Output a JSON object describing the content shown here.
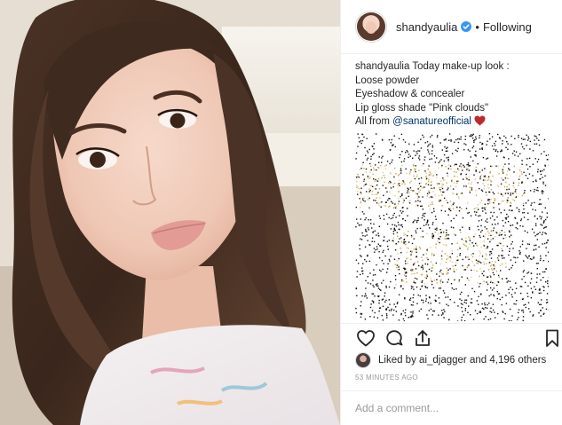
{
  "post": {
    "photo_alt": "",
    "author": {
      "username": "shandyaulia",
      "verified": true,
      "separator": "•",
      "follow_state": "Following"
    },
    "caption": {
      "username": "shandyaulia",
      "lines": [
        "Today make-up look :",
        "Loose powder",
        "Eyeshadow & concealer",
        "Lip gloss shade \"Pink clouds\""
      ],
      "last_line_prefix": "All from ",
      "mention": "@sanatureofficial"
    },
    "actions": {
      "like_icon": "heart-outline-icon",
      "comment_icon": "comment-bubble-icon",
      "share_icon": "share-arrow-icon",
      "save_icon": "bookmark-icon"
    },
    "likes": {
      "prefix": "Liked by ",
      "user": "ai_djagger",
      "middle": " and ",
      "others": "4,196 others"
    },
    "timestamp": "53 MINUTES AGO",
    "comment": {
      "placeholder": "Add a comment..."
    },
    "colors": {
      "text": "#262626",
      "muted": "#999999",
      "mention": "#003569",
      "verified": "#3897f0",
      "heart_emoji": "#c0282d",
      "border": "#efefef"
    }
  }
}
